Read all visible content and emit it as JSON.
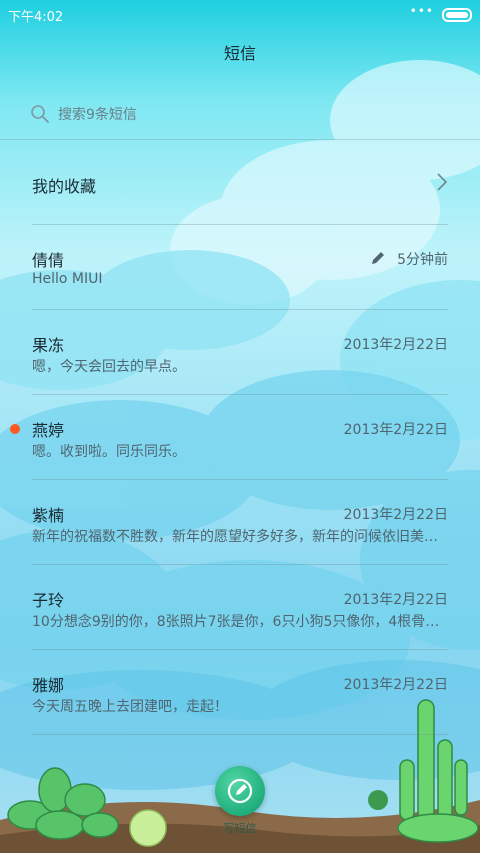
{
  "status": {
    "time": "下午4:02",
    "dots": "•••"
  },
  "header": {
    "title": "短信"
  },
  "search": {
    "placeholder": "搜索9条短信"
  },
  "favorites": {
    "label": "我的收藏"
  },
  "messages": [
    {
      "name": "倩倩",
      "preview": "Hello MIUI",
      "time": "5分钟前",
      "draft": true,
      "unread": false
    },
    {
      "name": "果冻",
      "preview": "嗯，今天会回去的早点。",
      "time": "2013年2月22日",
      "draft": false,
      "unread": false
    },
    {
      "name": "燕婷",
      "preview": "嗯。收到啦。同乐同乐。",
      "time": "2013年2月22日",
      "draft": false,
      "unread": true
    },
    {
      "name": "紫楠",
      "preview": "新年的祝福数不胜数，新年的愿望好多好多，新年的问候依旧美…",
      "time": "2013年2月22日",
      "draft": false,
      "unread": false
    },
    {
      "name": "子玲",
      "preview": "10分想念9别的你，8张照片7张是你，6只小狗5只像你，4根骨…",
      "time": "2013年2月22日",
      "draft": false,
      "unread": false
    },
    {
      "name": "雅娜",
      "preview": "今天周五晚上去团建吧，走起！",
      "time": "2013年2月22日",
      "draft": false,
      "unread": false
    }
  ],
  "compose": {
    "label": "写短信",
    "icon": "compose-icon"
  },
  "colors": {
    "accent": "#1fae7c",
    "unread": "#ff5a1f",
    "text": "#1b2b33",
    "secondary": "#4f6570"
  }
}
